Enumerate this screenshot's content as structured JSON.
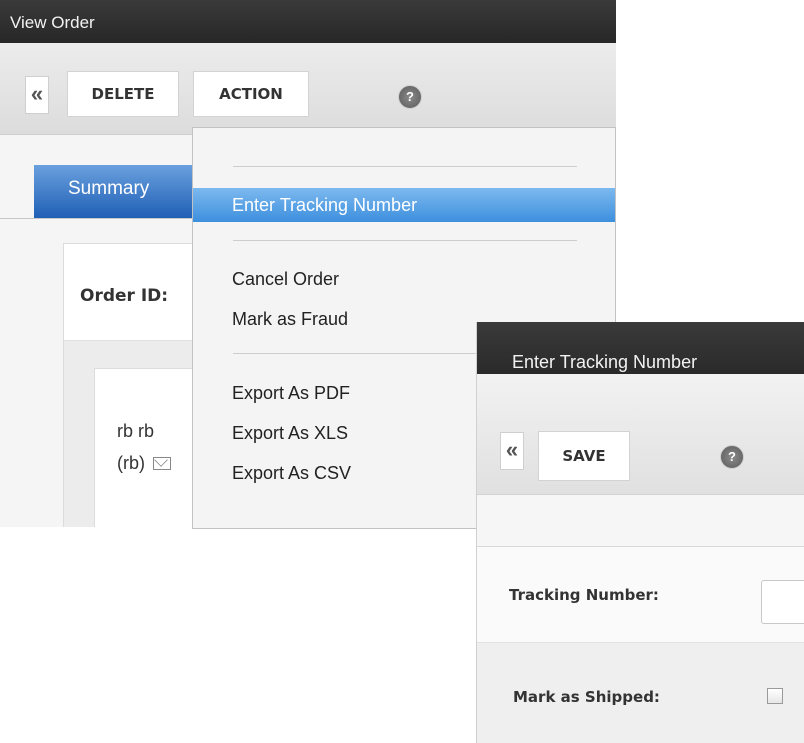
{
  "view_order": {
    "title": "View Order",
    "toolbar": {
      "back_icon": "chevron-left-icon",
      "delete_label": "DELETE",
      "action_label": "ACTION",
      "help_icon": "help-icon"
    },
    "tabs": [
      {
        "label": "Summary"
      }
    ],
    "order_id_label": "Order ID:",
    "customer": {
      "name": "rb rb",
      "alias": "(rb)",
      "mail_icon": "envelope-icon"
    }
  },
  "action_menu": {
    "items": [
      {
        "label": "Enter Tracking Number",
        "highlighted": true
      },
      {
        "label": "Cancel Order"
      },
      {
        "label": "Mark as Fraud"
      },
      {
        "label": "Export As PDF"
      },
      {
        "label": "Export As XLS"
      },
      {
        "label": "Export As CSV"
      }
    ]
  },
  "tracking_dialog": {
    "title": "Enter Tracking Number",
    "toolbar": {
      "back_icon": "chevron-left-icon",
      "save_label": "SAVE",
      "help_icon": "help-icon"
    },
    "fields": {
      "tracking_label": "Tracking Number:",
      "tracking_value": "",
      "shipped_label": "Mark as Shipped:",
      "shipped_checked": false
    }
  }
}
